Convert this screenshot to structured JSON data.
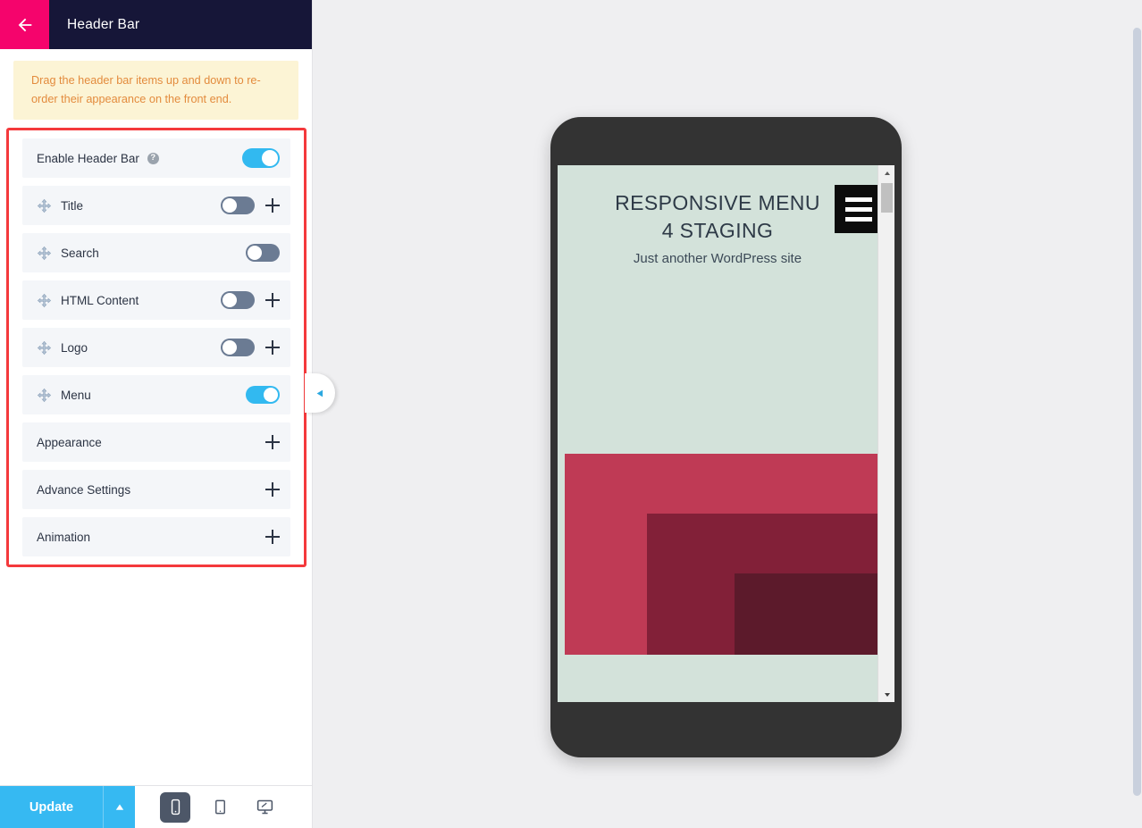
{
  "panel": {
    "title": "Header Bar",
    "back_icon": "arrow-left-icon",
    "notice": "Drag the header bar items up and down to re-order their appearance on the front end.",
    "accent_pink": "#f5046c",
    "header_bg": "#161638",
    "notice_bg": "#fcf4d5",
    "notice_text_color": "#e38b3d",
    "outline_color": "#f4393c",
    "toggle_on_color": "#32b9f0",
    "toggle_off_color": "#6b7b93"
  },
  "options": [
    {
      "label": "Enable Header Bar",
      "has_drag": false,
      "has_help": true,
      "help_glyph": "?",
      "toggle": "on",
      "has_plus": false
    },
    {
      "label": "Title",
      "has_drag": true,
      "has_help": false,
      "help_glyph": "",
      "toggle": "off",
      "has_plus": true
    },
    {
      "label": "Search",
      "has_drag": true,
      "has_help": false,
      "help_glyph": "",
      "toggle": "off",
      "has_plus": false
    },
    {
      "label": "HTML Content",
      "has_drag": true,
      "has_help": false,
      "help_glyph": "",
      "toggle": "off",
      "has_plus": true
    },
    {
      "label": "Logo",
      "has_drag": true,
      "has_help": false,
      "help_glyph": "",
      "toggle": "off",
      "has_plus": true
    },
    {
      "label": "Menu",
      "has_drag": true,
      "has_help": false,
      "help_glyph": "",
      "toggle": "on",
      "has_plus": false
    },
    {
      "label": "Appearance",
      "has_drag": false,
      "has_help": false,
      "help_glyph": "",
      "toggle": "none",
      "has_plus": true
    },
    {
      "label": "Advance Settings",
      "has_drag": false,
      "has_help": false,
      "help_glyph": "",
      "toggle": "none",
      "has_plus": true
    },
    {
      "label": "Animation",
      "has_drag": false,
      "has_help": false,
      "help_glyph": "",
      "toggle": "none",
      "has_plus": true
    }
  ],
  "bottom_bar": {
    "update_label": "Update",
    "caret_icon": "caret-up-icon",
    "button_color": "#36b9f2",
    "devices": [
      {
        "name": "mobile",
        "icon": "mobile-icon",
        "active": true
      },
      {
        "name": "tablet",
        "icon": "tablet-icon",
        "active": false
      },
      {
        "name": "desktop",
        "icon": "desktop-icon",
        "active": false
      }
    ]
  },
  "collapse_tab": {
    "icon": "caret-left-icon",
    "color": "#2ba8e0"
  },
  "preview": {
    "site_title": "RESPONSIVE MENU 4 STAGING",
    "site_tagline": "Just another WordPress site",
    "menu_icon": "hamburger-icon",
    "screen_bg": "#d3e2da",
    "title_color": "#2e3a47",
    "image_colors": [
      "#bf3a55",
      "#822038",
      "#5c1a2b"
    ],
    "scrollbar": {
      "up_icon": "caret-up-icon",
      "down_icon": "caret-down-icon"
    }
  }
}
